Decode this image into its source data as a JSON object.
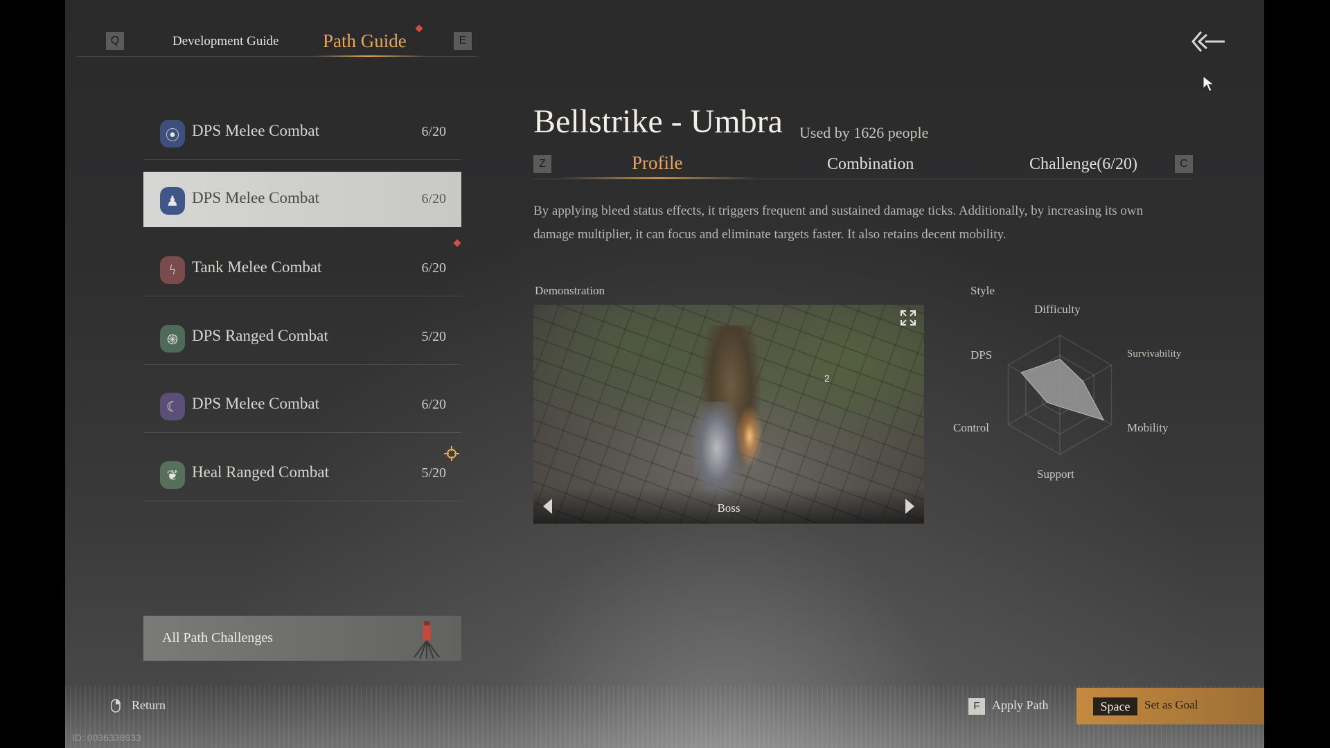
{
  "header": {
    "prev_key": "Q",
    "next_key": "E",
    "tabs": [
      {
        "label": "Development Guide",
        "active": false
      },
      {
        "label": "Path Guide",
        "active": true
      }
    ],
    "back_icon": "double-chevron-left-arrow-icon"
  },
  "paths": [
    {
      "label": "DPS Melee Combat",
      "count": "6/20",
      "icon": "wave-shield-icon",
      "icon_color": "#3d4f7a",
      "selected": false
    },
    {
      "label": "DPS Melee Combat",
      "count": "6/20",
      "icon": "figure-icon",
      "icon_color": "#3f5686",
      "selected": true
    },
    {
      "label": "Tank Melee Combat",
      "count": "6/20",
      "icon": "lightning-shield-icon",
      "icon_color": "#7a4b4b",
      "selected": false
    },
    {
      "label": "DPS Ranged Combat",
      "count": "5/20",
      "icon": "swirl-icon",
      "icon_color": "#4f6a58",
      "selected": false
    },
    {
      "label": "DPS Melee Combat",
      "count": "6/20",
      "icon": "crescent-icon",
      "icon_color": "#5b4f7a",
      "selected": false
    },
    {
      "label": "Heal Ranged Combat",
      "count": "5/20",
      "icon": "leaf-icon",
      "icon_color": "#56705a",
      "selected": false
    }
  ],
  "all_path_challenges": {
    "label": "All Path Challenges"
  },
  "detail": {
    "title": "Bellstrike - Umbra",
    "used_by": "Used by 1626 people",
    "prev_key": "Z",
    "next_key": "C",
    "tabs": [
      {
        "label": "Profile",
        "active": true
      },
      {
        "label": "Combination",
        "active": false
      },
      {
        "label": "Challenge(6/20)",
        "active": false
      }
    ],
    "description": "By applying bleed status effects, it triggers frequent and sustained damage ticks. Additionally, by increasing its own damage multiplier, it can focus and eliminate targets faster. It also retains decent mobility.",
    "demonstration_label": "Demonstration",
    "demo_caption": "Boss",
    "demo_marker": "2",
    "style_label": "Style",
    "radar": {
      "axes": [
        "Difficulty",
        "Survivability",
        "Mobility",
        "Support",
        "Control",
        "DPS"
      ],
      "values": [
        0.6,
        0.45,
        0.85,
        0.2,
        0.25,
        0.75
      ],
      "fill_color": "#9a9a9a"
    }
  },
  "footer": {
    "return_label": "Return",
    "apply_key": "F",
    "apply_label": "Apply Path",
    "goal_key": "Space",
    "goal_label": "Set as Goal",
    "uid": "ID: 0036338933"
  },
  "colors": {
    "accent": "#e5a75b",
    "notify": "#d94a43",
    "goal_button": "#c48a40"
  }
}
